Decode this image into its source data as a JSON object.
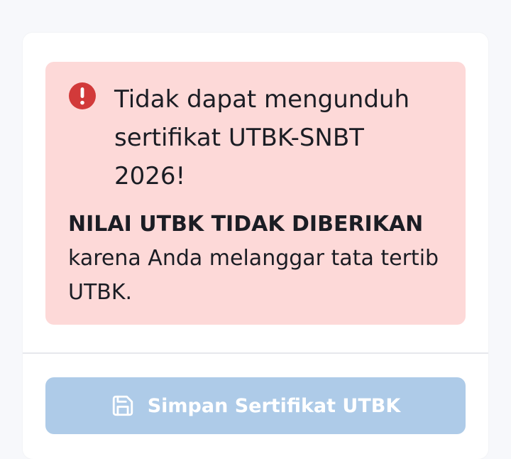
{
  "alert": {
    "icon": "exclamation-circle-icon",
    "title": "Tidak dapat mengunduh sertifikat UTBK-SNBT 2026!",
    "emphasis": "NILAI UTBK TIDAK DIBERIKAN",
    "message": "karena Anda melanggar tata tertib UTBK.",
    "colors": {
      "background": "#fdd9d8",
      "icon": "#d23a3a"
    }
  },
  "download_button": {
    "icon": "save-icon",
    "label": "Simpan Sertifikat UTBK",
    "disabled": true,
    "color": "#aecbe8"
  }
}
